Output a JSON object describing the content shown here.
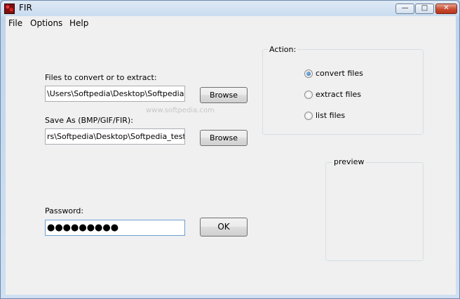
{
  "window": {
    "title": "FIR",
    "controls": {
      "minimize": "—",
      "maximize": "□",
      "close": "✕"
    }
  },
  "menu": [
    "File",
    "Options",
    "Help"
  ],
  "form": {
    "files_label": "Files to convert or to extract:",
    "files_value": "\\Users\\Softpedia\\Desktop\\Softpedia.odt",
    "browse1_label": "Browse",
    "save_label": "Save As (BMP/GIF/FIR):",
    "save_value": "rs\\Softpedia\\Desktop\\Softpedia_test.bm",
    "browse2_label": "Browse",
    "password_label": "Password:",
    "password_value": "●●●●●●●●●",
    "ok_label": "OK"
  },
  "action": {
    "title": "Action:",
    "options": [
      {
        "label": "convert files",
        "checked": true
      },
      {
        "label": "extract files",
        "checked": false
      },
      {
        "label": "list files",
        "checked": false
      }
    ]
  },
  "preview": {
    "title": "preview"
  },
  "watermark": {
    "text": "www.softpedia.com"
  },
  "colors": {
    "accent": "#1e5fa8",
    "close_button": "#c74b32",
    "window_frame": "#bfd4ec"
  }
}
